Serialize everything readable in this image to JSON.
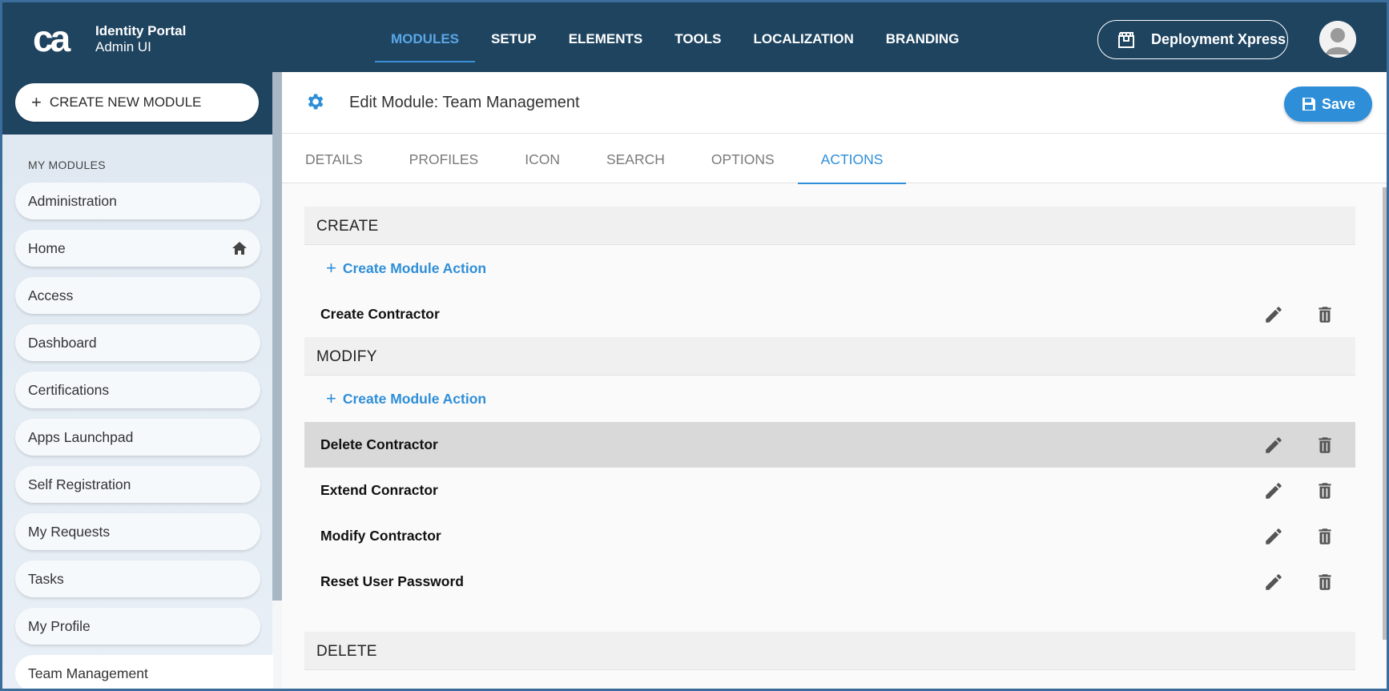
{
  "app": {
    "logo_text": "ca",
    "title_line1": "Identity Portal",
    "title_line2": "Admin UI"
  },
  "nav": {
    "items": [
      {
        "label": "MODULES",
        "active": true
      },
      {
        "label": "SETUP"
      },
      {
        "label": "ELEMENTS"
      },
      {
        "label": "TOOLS"
      },
      {
        "label": "LOCALIZATION"
      },
      {
        "label": "BRANDING"
      }
    ],
    "deploy_label": "Deployment Xpress"
  },
  "sidebar": {
    "create_label": "CREATE NEW MODULE",
    "section_label": "MY MODULES",
    "items": [
      {
        "label": "Administration"
      },
      {
        "label": "Home",
        "icon": "home-icon"
      },
      {
        "label": "Access"
      },
      {
        "label": "Dashboard"
      },
      {
        "label": "Certifications"
      },
      {
        "label": "Apps Launchpad"
      },
      {
        "label": "Self Registration"
      },
      {
        "label": "My Requests"
      },
      {
        "label": "Tasks"
      },
      {
        "label": "My Profile"
      },
      {
        "label": "Team Management",
        "active": true
      }
    ]
  },
  "main": {
    "title": "Edit Module: Team Management",
    "save_label": "Save",
    "tabs": [
      {
        "label": "DETAILS"
      },
      {
        "label": "PROFILES"
      },
      {
        "label": "ICON"
      },
      {
        "label": "SEARCH"
      },
      {
        "label": "OPTIONS"
      },
      {
        "label": "ACTIONS",
        "active": true
      }
    ],
    "sections": {
      "create": {
        "title": "CREATE",
        "add_label": "Create Module Action",
        "actions": [
          "Create Contractor"
        ]
      },
      "modify": {
        "title": "MODIFY",
        "add_label": "Create Module Action",
        "actions": [
          "Delete Contractor",
          "Extend Conractor",
          "Modify Contractor",
          "Reset User Password"
        ]
      },
      "delete": {
        "title": "DELETE"
      }
    }
  },
  "colors": {
    "header_bg": "#1f4460",
    "accent": "#2e8ed8",
    "nav_active": "#5aa7e6"
  }
}
